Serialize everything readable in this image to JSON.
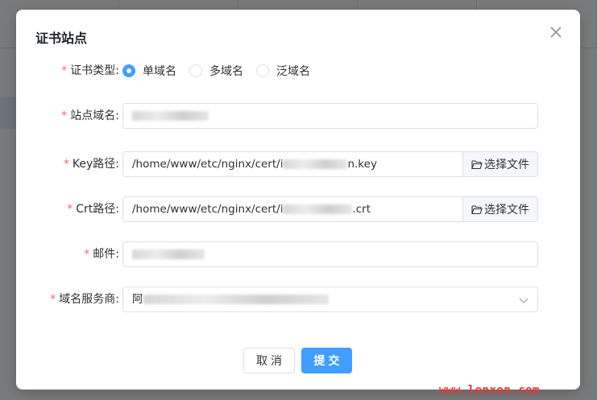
{
  "dialog": {
    "title": "证书站点",
    "close_icon": "close-icon"
  },
  "form": {
    "cert_type": {
      "required_mark": "*",
      "label": "证书类型:",
      "options": [
        {
          "label": "单域名",
          "selected": true
        },
        {
          "label": "多域名",
          "selected": false
        },
        {
          "label": "泛域名",
          "selected": false
        }
      ]
    },
    "site_domain": {
      "required_mark": "*",
      "label": "站点域名:",
      "value": ""
    },
    "key_path": {
      "required_mark": "*",
      "label": "Key路径:",
      "value_prefix": "/home/www/etc/nginx/cert/i",
      "value_suffix": "n.key",
      "button_label": "选择文件",
      "button_icon": "folder-open-icon"
    },
    "crt_path": {
      "required_mark": "*",
      "label": "Crt路径:",
      "value_prefix": "/home/www/etc/nginx/cert/i",
      "value_suffix": ".crt",
      "button_label": "选择文件",
      "button_icon": "folder-open-icon"
    },
    "email": {
      "required_mark": "*",
      "label": "邮件:",
      "value": ""
    },
    "dns_provider": {
      "required_mark": "*",
      "label": "域名服务商:",
      "value_prefix": "阿",
      "dropdown_icon": "chevron-down-icon"
    }
  },
  "footer": {
    "cancel_label": "取消",
    "submit_label": "提交"
  },
  "watermark": "www.lenxen.com",
  "colors": {
    "primary": "#409eff",
    "required": "#f56c6c",
    "watermark": "#e53935"
  }
}
